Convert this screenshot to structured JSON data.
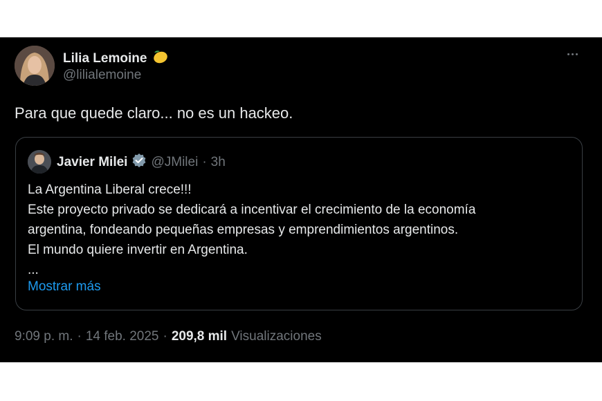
{
  "author": {
    "name": "Lilia Lemoine",
    "handle": "@lilialemoine",
    "emoji_icon": "lemon-icon"
  },
  "tweet": {
    "text": "Para que quede claro... no es un hackeo."
  },
  "quoted": {
    "name": "Javier Milei",
    "verified_icon": "verified-badge-icon",
    "handle": "@JMilei",
    "separator": "·",
    "time": "3h",
    "lines": [
      "La Argentina Liberal crece!!!",
      "Este proyecto privado se dedicará a incentivar el crecimiento de la economía",
      "argentina, fondeando pequeñas empresas y emprendimientos argentinos.",
      "El mundo quiere invertir en Argentina.",
      "..."
    ],
    "show_more": "Mostrar más"
  },
  "meta": {
    "time": "9:09 p. m.",
    "sep1": "·",
    "date": "14 feb. 2025",
    "sep2": "·",
    "views_count": "209,8 mil",
    "views_label": "Visualizaciones"
  },
  "colors": {
    "background": "#000000",
    "text": "#e7e9ea",
    "muted": "#71767b",
    "link": "#1d9bf0",
    "border": "#3a3f44",
    "verified": "#829aab"
  }
}
